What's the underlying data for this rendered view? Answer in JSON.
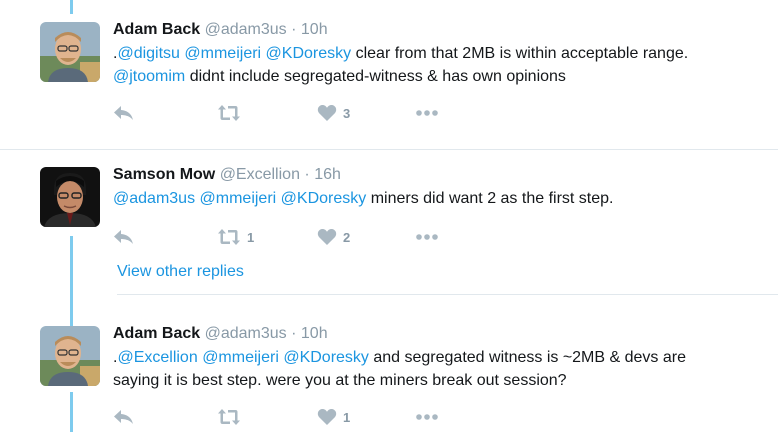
{
  "tweets": [
    {
      "name": "Adam Back",
      "handle": "@adam3us",
      "dot": "·",
      "time": "10h",
      "line1": [
        {
          "t": "."
        },
        {
          "t": "@digitsu",
          "m": true
        },
        {
          "t": " "
        },
        {
          "t": "@mmeijeri",
          "m": true
        },
        {
          "t": " "
        },
        {
          "t": "@KDoresky",
          "m": true
        },
        {
          "t": " clear from that 2MB is within acceptable range."
        }
      ],
      "line2": [
        {
          "t": "@jtoomim",
          "m": true
        },
        {
          "t": " didnt include segregated-witness & has own opinions"
        }
      ],
      "retweets": "",
      "likes": "3"
    },
    {
      "name": "Samson Mow",
      "handle": "@Excellion",
      "dot": "·",
      "time": "16h",
      "line1": [
        {
          "t": "@adam3us",
          "m": true
        },
        {
          "t": " "
        },
        {
          "t": "@mmeijeri",
          "m": true
        },
        {
          "t": " "
        },
        {
          "t": "@KDoresky",
          "m": true
        },
        {
          "t": " miners did want 2 as the first step."
        }
      ],
      "line2": [],
      "retweets": "1",
      "likes": "2"
    },
    {
      "name": "Adam Back",
      "handle": "@adam3us",
      "dot": "·",
      "time": "10h",
      "line1": [
        {
          "t": "."
        },
        {
          "t": "@Excellion",
          "m": true
        },
        {
          "t": " "
        },
        {
          "t": "@mmeijeri",
          "m": true
        },
        {
          "t": " "
        },
        {
          "t": "@KDoresky",
          "m": true
        },
        {
          "t": " and segregated witness is ~2MB & devs are"
        }
      ],
      "line2": [
        {
          "t": "saying it is best step. were you at the miners break out session?"
        }
      ],
      "retweets": "",
      "likes": "1"
    }
  ],
  "view_other_replies": "View other replies",
  "colors": {
    "mention": "#1b95e0",
    "thread_line": "#7ecbee",
    "icon": "#aab8c2",
    "meta": "#8899a6",
    "separator": "#e1e8ed"
  },
  "icons": [
    "reply-icon",
    "retweet-icon",
    "like-icon",
    "more-icon"
  ]
}
